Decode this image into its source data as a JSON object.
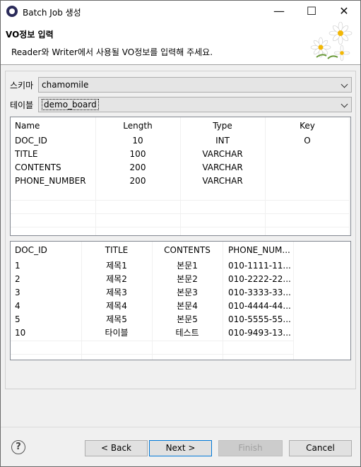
{
  "window": {
    "title": "Batch Job 생성",
    "minimize_glyph": "—",
    "maximize_glyph": "☐",
    "close_glyph": "✕"
  },
  "header": {
    "title": "VO정보 입력",
    "description": "Reader와 Writer에서 사용될 VO정보를 입력해 주세요."
  },
  "form": {
    "schema_label": "스키마",
    "schema_value": "chamomile",
    "table_label": "테이블",
    "table_value": "demo_board"
  },
  "columns_table": {
    "headers": [
      "Name",
      "Length",
      "Type",
      "Key"
    ],
    "rows": [
      [
        "DOC_ID",
        "10",
        "INT",
        "O"
      ],
      [
        "TITLE",
        "100",
        "VARCHAR",
        ""
      ],
      [
        "CONTENTS",
        "200",
        "VARCHAR",
        ""
      ],
      [
        "PHONE_NUMBER",
        "200",
        "VARCHAR",
        ""
      ]
    ]
  },
  "data_table": {
    "headers": [
      "DOC_ID",
      "TITLE",
      "CONTENTS",
      "PHONE_NUM..."
    ],
    "rows": [
      [
        "1",
        "제목1",
        "본문1",
        "010-1111-11..."
      ],
      [
        "2",
        "제목2",
        "본문2",
        "010-2222-22..."
      ],
      [
        "3",
        "제목3",
        "본문3",
        "010-3333-33..."
      ],
      [
        "4",
        "제목4",
        "본문4",
        "010-4444-44..."
      ],
      [
        "5",
        "제목5",
        "본문5",
        "010-5555-55..."
      ],
      [
        "10",
        "타이블",
        "테스트",
        "010-9493-13..."
      ]
    ]
  },
  "buttons": {
    "help_glyph": "?",
    "back": "< Back",
    "next": "Next >",
    "finish": "Finish",
    "cancel": "Cancel"
  },
  "icons": {
    "app": "eclipse-app-icon",
    "banner": "chamomile-flowers-icon",
    "help": "help-icon"
  }
}
